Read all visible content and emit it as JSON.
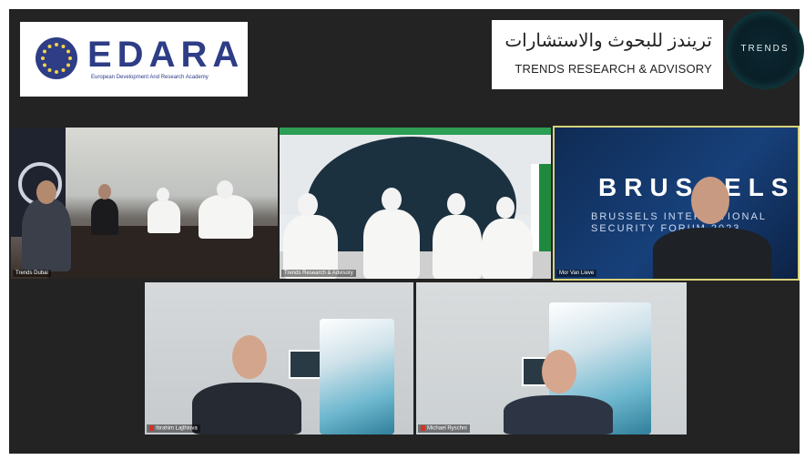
{
  "logos": {
    "edara": {
      "name": "EDARA",
      "subtitle": "European Development And Research Academy"
    },
    "trends": {
      "arabic": "تريندز للبحوث والاستشارات",
      "english": "TRENDS RESEARCH & ADVISORY",
      "badge": "TRENDS"
    }
  },
  "participants": [
    {
      "label": "Trends Dubai"
    },
    {
      "label": "Trends Research & Advisory"
    },
    {
      "label": "Mor Van Lieve",
      "slide_title": "BRUSSELS",
      "slide_subtitle": "BRUSSELS INTERNATIONAL SECURITY FORUM 2023"
    },
    {
      "label": "Ibrahim Lajthiova"
    },
    {
      "label": "Michael Ryschni"
    }
  ],
  "colors": {
    "background": "#232323",
    "edara_blue": "#2e3d86",
    "active_border": "#d8d27a",
    "mic_muted": "#d93025"
  }
}
